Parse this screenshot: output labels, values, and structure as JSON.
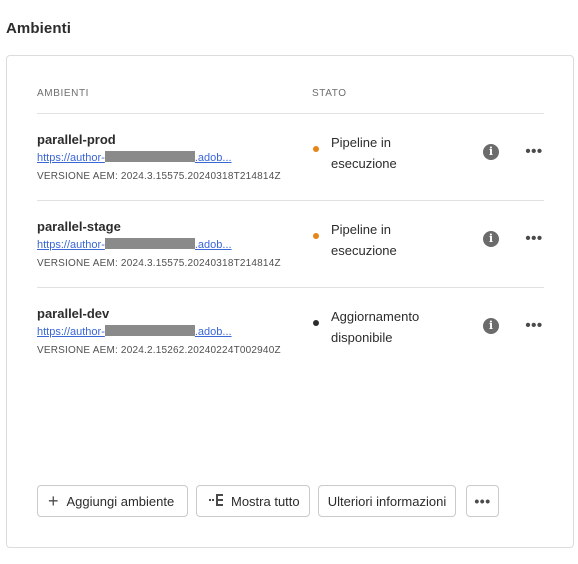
{
  "section": {
    "title": "Ambienti"
  },
  "table": {
    "headers": {
      "environments": "AMBIENTI",
      "status": "STATO"
    },
    "rows": [
      {
        "name": "parallel-prod",
        "link_prefix": "https://author-",
        "link_suffix": ".adob...",
        "version": "VERSIONE AEM: 2024.3.15575.20240318T214814Z",
        "status": "Pipeline in esecuzione",
        "status_color": "#e68619"
      },
      {
        "name": "parallel-stage",
        "link_prefix": "https://author-",
        "link_suffix": ".adob...",
        "version": "VERSIONE AEM: 2024.3.15575.20240318T214814Z",
        "status": "Pipeline in esecuzione",
        "status_color": "#e68619"
      },
      {
        "name": "parallel-dev",
        "link_prefix": "https://author-",
        "link_suffix": ".adob...",
        "version": "VERSIONE AEM: 2024.2.15262.20240224T002940Z",
        "status": "Aggiornamento disponibile",
        "status_color": "#2c2c2c"
      }
    ]
  },
  "icons": {
    "info": "info-icon",
    "more": "more-options-icon",
    "add": "plus-icon",
    "show_all": "tree-view-icon"
  },
  "actions": {
    "add_label": "Aggiungi ambiente",
    "show_all_label": "Mostra tutto",
    "more_info_label": "Ulteriori informazioni"
  }
}
